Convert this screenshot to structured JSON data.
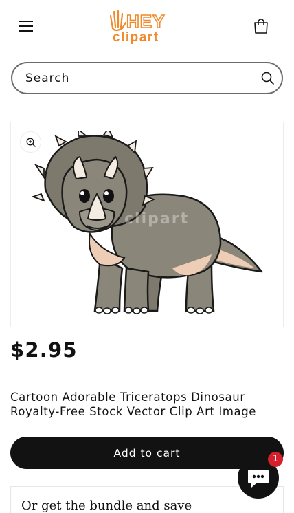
{
  "header": {
    "logo": {
      "line1": "HEY",
      "line2": "clipart"
    },
    "menu_icon": "hamburger-menu-icon",
    "cart_icon": "shopping-bag-icon"
  },
  "search": {
    "placeholder": "Search",
    "icon": "search-icon"
  },
  "product": {
    "image_icon": "triceratops-illustration",
    "zoom_icon": "zoom-in-icon",
    "watermark": "clipart",
    "price": "$2.95",
    "title": "Cartoon Adorable Triceratops Dinosaur Royalty-Free Stock Vector Clip Art Image",
    "add_to_cart_label": "Add to cart"
  },
  "bundle": {
    "heading": "Or get the bundle and save"
  },
  "chat": {
    "icon": "chat-bubble-icon",
    "badge_count": "1"
  },
  "colors": {
    "logo_orange": "#f08a2b",
    "button_dark": "#121212",
    "badge_red": "#d4202b",
    "dino_gray": "#8a8679",
    "dino_belly": "#eecdb6"
  }
}
